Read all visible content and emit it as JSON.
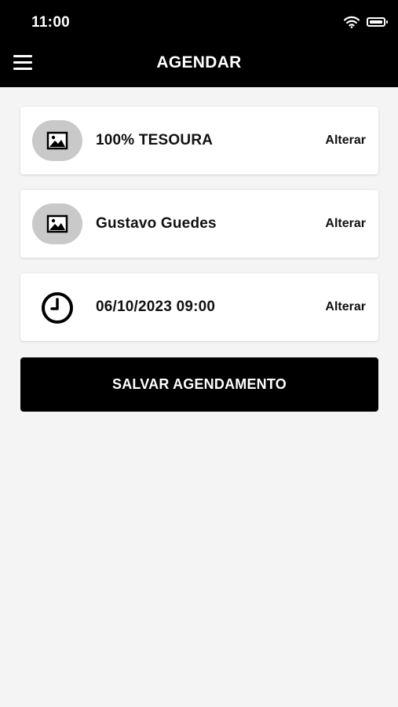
{
  "status_bar": {
    "time": "11:00",
    "icons": [
      "wifi-icon",
      "battery-icon"
    ]
  },
  "header": {
    "title": "AGENDAR",
    "menu_icon": "hamburger-menu-icon"
  },
  "cards": [
    {
      "icon": "image-placeholder-icon",
      "label": "100% TESOURA",
      "action": "Alterar"
    },
    {
      "icon": "image-placeholder-icon",
      "label": "Gustavo Guedes",
      "action": "Alterar"
    },
    {
      "icon": "clock-icon",
      "label": "06/10/2023 09:00",
      "action": "Alterar"
    }
  ],
  "save_button": {
    "label": "SALVAR AGENDAMENTO"
  },
  "colors": {
    "header_bg": "#000000",
    "page_bg": "#f4f4f4",
    "card_bg": "#ffffff",
    "avatar_bg": "#c9c9c9",
    "button_bg": "#000000"
  }
}
